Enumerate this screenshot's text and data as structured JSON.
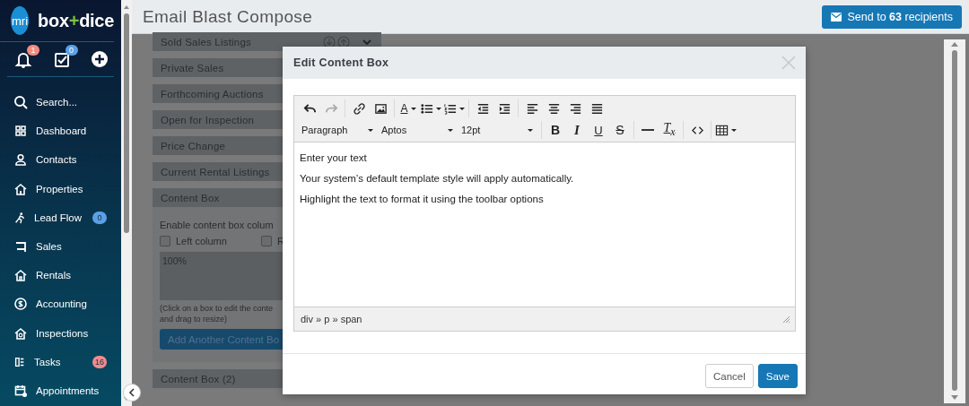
{
  "sidebar": {
    "brand": {
      "logo": "mri",
      "name_start": "box",
      "name_join": "+",
      "name_end": "dice"
    },
    "quick_actions": [
      {
        "kind": "bell",
        "badge": "1",
        "color": "#f28b82"
      },
      {
        "kind": "tasks",
        "badge": "0",
        "color": "#5aa0e6"
      },
      {
        "kind": "add"
      }
    ],
    "nav": [
      {
        "kind": "search",
        "label": "Search..."
      },
      {
        "kind": "dashboard",
        "label": "Dashboard"
      },
      {
        "kind": "contacts",
        "label": "Contacts"
      },
      {
        "kind": "properties",
        "label": "Properties"
      },
      {
        "kind": "leadflow",
        "label": "Lead Flow",
        "badge": "0",
        "color": "#5aa0e6"
      },
      {
        "kind": "sales",
        "label": "Sales"
      },
      {
        "kind": "rentals",
        "label": "Rentals"
      },
      {
        "kind": "accounting",
        "label": "Accounting"
      },
      {
        "kind": "inspections",
        "label": "Inspections"
      },
      {
        "kind": "tasks",
        "label": "Tasks",
        "badge": "16",
        "color": "#f08c8c"
      },
      {
        "kind": "appointments",
        "label": "Appointments"
      }
    ]
  },
  "header": {
    "title": "Email Blast Compose",
    "send_button": "Send to **63** recipients"
  },
  "sections": [
    {
      "title": "Sold Sales Listings",
      "has_tools": true
    },
    {
      "title": "Private Sales"
    },
    {
      "title": "Forthcoming Auctions"
    },
    {
      "title": "Open for Inspection"
    },
    {
      "title": "Price Change"
    },
    {
      "title": "Current Rental Listings"
    },
    {
      "title": "Content Box",
      "body": {
        "label": "Enable content box colum",
        "checkboxes": [
          {
            "label": "Left column",
            "checked": false
          },
          {
            "label": "R",
            "checked": false
          }
        ],
        "box_text": "100%",
        "hint": "(Click on a box to edit the conte\nand drag to resize)",
        "add_button": "Add Another Content Bo"
      }
    },
    {
      "title": "Content Box (2)"
    }
  ],
  "modal": {
    "title": "Edit Content Box",
    "toolbar": [
      [
        [
          {
            "kind": "undo",
            "disabled": false
          },
          {
            "kind": "redo",
            "disabled": true
          }
        ],
        [
          {
            "kind": "link",
            "disabled": false
          },
          {
            "kind": "image",
            "disabled": false
          }
        ],
        [
          {
            "kind": "forecolor",
            "label": "A",
            "disabled": false
          },
          {
            "kind": "bullist",
            "disabled": false
          },
          {
            "kind": "numlist",
            "disabled": false
          }
        ],
        [
          {
            "kind": "outdent",
            "disabled": false
          },
          {
            "kind": "indent",
            "disabled": false
          }
        ],
        [
          {
            "kind": "alignleft",
            "disabled": false
          },
          {
            "kind": "aligncenter",
            "disabled": false
          },
          {
            "kind": "alignright",
            "disabled": false
          },
          {
            "kind": "justify",
            "disabled": false
          }
        ]
      ],
      [
        [
          {
            "kind": "select",
            "label": "Paragraph",
            "disabled": false
          },
          {
            "kind": "select",
            "label": "Aptos",
            "disabled": false
          },
          {
            "kind": "select",
            "label": "12pt",
            "disabled": false
          }
        ],
        [
          {
            "kind": "bold",
            "label": "B",
            "disabled": false
          },
          {
            "kind": "italic",
            "label": "I",
            "disabled": false
          },
          {
            "kind": "underline",
            "label": "U",
            "disabled": false
          },
          {
            "kind": "strike",
            "label": "S",
            "disabled": false
          }
        ],
        [
          {
            "kind": "hr",
            "disabled": false
          },
          {
            "kind": "removeformat",
            "label": "T$_{x}$",
            "disabled": false
          }
        ],
        [
          {
            "kind": "code",
            "disabled": false
          }
        ],
        [
          {
            "kind": "table",
            "disabled": false
          }
        ]
      ]
    ],
    "content": [
      "Enter your text",
      "Your system’s default template style will apply automatically.",
      "Highlight the text to format it using the toolbar options"
    ],
    "path": "div » p » span",
    "buttons": [
      {
        "label": "Cancel",
        "kind": "secondary"
      },
      {
        "label": "Save",
        "kind": "primary"
      }
    ]
  }
}
